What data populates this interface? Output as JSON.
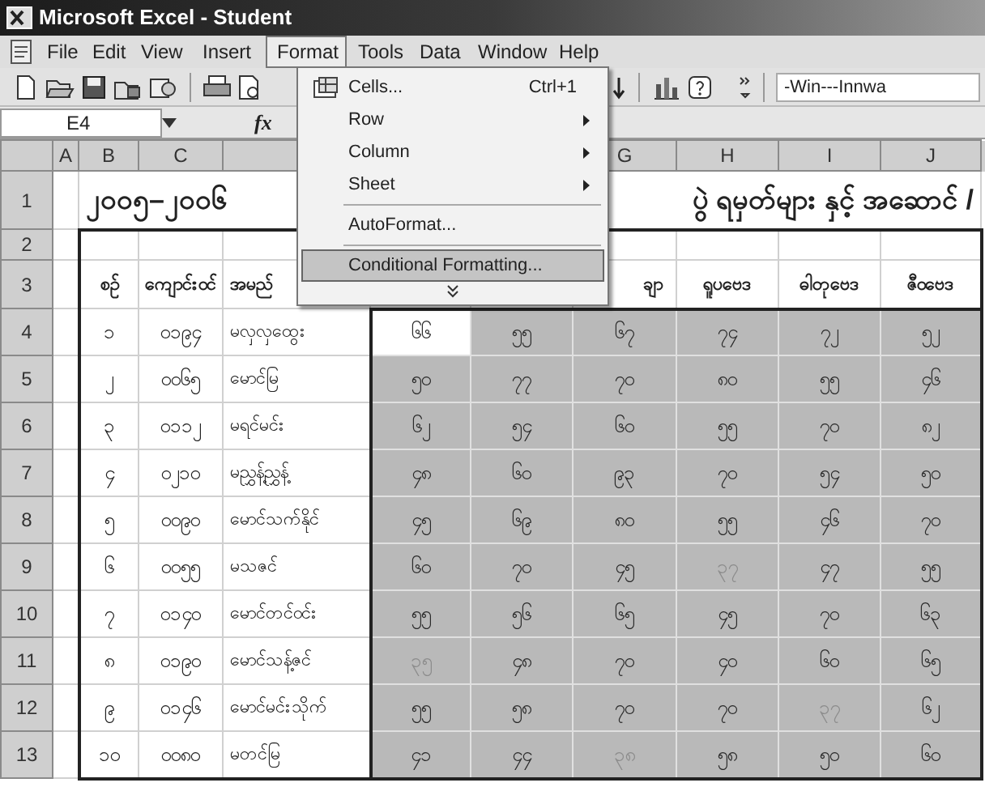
{
  "window": {
    "title": "Microsoft Excel - Student"
  },
  "menu_bar": [
    {
      "label": "File",
      "selected": false
    },
    {
      "label": "Edit",
      "selected": false
    },
    {
      "label": "View",
      "selected": false
    },
    {
      "label": "Insert",
      "selected": false
    },
    {
      "label": "Format",
      "selected": true
    },
    {
      "label": "Tools",
      "selected": false
    },
    {
      "label": "Data",
      "selected": false
    },
    {
      "label": "Window",
      "selected": false
    },
    {
      "label": "Help",
      "selected": false
    }
  ],
  "toolbar": {
    "font": "-Win---Innwa"
  },
  "formula_bar": {
    "name_box": "E4",
    "fx": "fx"
  },
  "column_headers": [
    "A",
    "B",
    "C",
    "G",
    "H",
    "I",
    "J"
  ],
  "row_headers": [
    "1",
    "2",
    "3",
    "4",
    "5",
    "6",
    "7",
    "8",
    "9",
    "10",
    "11",
    "12",
    "13"
  ],
  "title_left": "၂၀၀၅–၂၀၀၆",
  "title_right": "ပွဲ ရမှတ်များ နှင့် အဆောင် /",
  "headers": [
    "စဉ်",
    "ကျောင်းဝင်",
    "အမည်",
    "ချာ",
    "ရူပဗေဒ",
    "ဓါတုဗေဒ",
    "ဇီဝဗေဒ"
  ],
  "rows": [
    {
      "number": "၁",
      "id": "၀၁၉၄",
      "name": "မလှလှထွေး",
      "scores": [
        {
          "text": "၆၆",
          "dimmed": false,
          "selected": true
        },
        {
          "text": "၅၅",
          "dimmed": false,
          "selected": false
        },
        {
          "text": "၆၇",
          "dimmed": false,
          "selected": false
        },
        {
          "text": "၇၄",
          "dimmed": false,
          "selected": false
        },
        {
          "text": "၇၂",
          "dimmed": false,
          "selected": false
        },
        {
          "text": "၅၂",
          "dimmed": false,
          "selected": false
        }
      ]
    },
    {
      "number": "၂",
      "id": "၀၀၆၅",
      "name": "မောင်မြ",
      "scores": [
        {
          "text": "၅၀",
          "dimmed": false,
          "selected": false
        },
        {
          "text": "၇၇",
          "dimmed": false,
          "selected": false
        },
        {
          "text": "၇၀",
          "dimmed": false,
          "selected": false
        },
        {
          "text": "၈၀",
          "dimmed": false,
          "selected": false
        },
        {
          "text": "၅၅",
          "dimmed": false,
          "selected": false
        },
        {
          "text": "၄၆",
          "dimmed": false,
          "selected": false
        }
      ]
    },
    {
      "number": "၃",
      "id": "၀၁၁၂",
      "name": "မရင်မင်း",
      "scores": [
        {
          "text": "၆၂",
          "dimmed": false,
          "selected": false
        },
        {
          "text": "၅၄",
          "dimmed": false,
          "selected": false
        },
        {
          "text": "၆၀",
          "dimmed": false,
          "selected": false
        },
        {
          "text": "၅၅",
          "dimmed": false,
          "selected": false
        },
        {
          "text": "၇၀",
          "dimmed": false,
          "selected": false
        },
        {
          "text": "၈၂",
          "dimmed": false,
          "selected": false
        }
      ]
    },
    {
      "number": "၄",
      "id": "၀၂၁၀",
      "name": "မညွှန့်ညွှန့်",
      "scores": [
        {
          "text": "၄၈",
          "dimmed": false,
          "selected": false
        },
        {
          "text": "၆၀",
          "dimmed": false,
          "selected": false
        },
        {
          "text": "၉၃",
          "dimmed": false,
          "selected": false
        },
        {
          "text": "၇၀",
          "dimmed": false,
          "selected": false
        },
        {
          "text": "၅၄",
          "dimmed": false,
          "selected": false
        },
        {
          "text": "၅၀",
          "dimmed": false,
          "selected": false
        }
      ]
    },
    {
      "number": "၅",
      "id": "၀၀၉၀",
      "name": "မောင်သက်နိုင်",
      "scores": [
        {
          "text": "၄၅",
          "dimmed": false,
          "selected": false
        },
        {
          "text": "၆၉",
          "dimmed": false,
          "selected": false
        },
        {
          "text": "၈၀",
          "dimmed": false,
          "selected": false
        },
        {
          "text": "၅၅",
          "dimmed": false,
          "selected": false
        },
        {
          "text": "၄၆",
          "dimmed": false,
          "selected": false
        },
        {
          "text": "၇၀",
          "dimmed": false,
          "selected": false
        }
      ]
    },
    {
      "number": "၆",
      "id": "၀၀၅၅",
      "name": "မသဇင်",
      "scores": [
        {
          "text": "၆၀",
          "dimmed": false,
          "selected": false
        },
        {
          "text": "၇၀",
          "dimmed": false,
          "selected": false
        },
        {
          "text": "၄၅",
          "dimmed": false,
          "selected": false
        },
        {
          "text": "၃၇",
          "dimmed": true,
          "selected": false
        },
        {
          "text": "၄၇",
          "dimmed": false,
          "selected": false
        },
        {
          "text": "၅၅",
          "dimmed": false,
          "selected": false
        }
      ]
    },
    {
      "number": "၇",
      "id": "၀၁၄၀",
      "name": "မောင်တင်ဝင်း",
      "scores": [
        {
          "text": "၅၅",
          "dimmed": false,
          "selected": false
        },
        {
          "text": "၅၆",
          "dimmed": false,
          "selected": false
        },
        {
          "text": "၆၅",
          "dimmed": false,
          "selected": false
        },
        {
          "text": "၄၅",
          "dimmed": false,
          "selected": false
        },
        {
          "text": "၇၀",
          "dimmed": false,
          "selected": false
        },
        {
          "text": "၆၃",
          "dimmed": false,
          "selected": false
        }
      ]
    },
    {
      "number": "၈",
      "id": "၀၁၉၀",
      "name": "မောင်သန့်ဇင်",
      "scores": [
        {
          "text": "၃၅",
          "dimmed": true,
          "selected": false
        },
        {
          "text": "၄၈",
          "dimmed": false,
          "selected": false
        },
        {
          "text": "၇၀",
          "dimmed": false,
          "selected": false
        },
        {
          "text": "၄၀",
          "dimmed": false,
          "selected": false
        },
        {
          "text": "၆၀",
          "dimmed": false,
          "selected": false
        },
        {
          "text": "၆၅",
          "dimmed": false,
          "selected": false
        }
      ]
    },
    {
      "number": "၉",
      "id": "၀၁၄၆",
      "name": "မောင်မင်းသိုက်",
      "scores": [
        {
          "text": "၅၅",
          "dimmed": false,
          "selected": false
        },
        {
          "text": "၅၈",
          "dimmed": false,
          "selected": false
        },
        {
          "text": "၇၀",
          "dimmed": false,
          "selected": false
        },
        {
          "text": "၇၀",
          "dimmed": false,
          "selected": false
        },
        {
          "text": "၃၇",
          "dimmed": true,
          "selected": false
        },
        {
          "text": "၆၂",
          "dimmed": false,
          "selected": false
        }
      ]
    },
    {
      "number": "၁၀",
      "id": "၀၀၈၀",
      "name": "မတင်မြ",
      "scores": [
        {
          "text": "၄၁",
          "dimmed": false,
          "selected": false
        },
        {
          "text": "၄၄",
          "dimmed": false,
          "selected": false
        },
        {
          "text": "၃၈",
          "dimmed": true,
          "selected": false
        },
        {
          "text": "၅၈",
          "dimmed": false,
          "selected": false
        },
        {
          "text": "၅၀",
          "dimmed": false,
          "selected": false
        },
        {
          "text": "၆၀",
          "dimmed": false,
          "selected": false
        }
      ]
    }
  ],
  "format_menu": [
    {
      "kind": "item",
      "label": "Cells...",
      "shortcut": "Ctrl+1",
      "submenu": false,
      "selected": false
    },
    {
      "kind": "item",
      "label": "Row",
      "submenu": true,
      "selected": false
    },
    {
      "kind": "item",
      "label": "Column",
      "submenu": true,
      "selected": false
    },
    {
      "kind": "item",
      "label": "Sheet",
      "submenu": true,
      "selected": false
    },
    {
      "kind": "separator"
    },
    {
      "kind": "item",
      "label": "AutoFormat...",
      "submenu": false,
      "selected": false
    },
    {
      "kind": "separator"
    },
    {
      "kind": "item",
      "label": "Conditional Formatting...",
      "submenu": false,
      "selected": true
    }
  ]
}
